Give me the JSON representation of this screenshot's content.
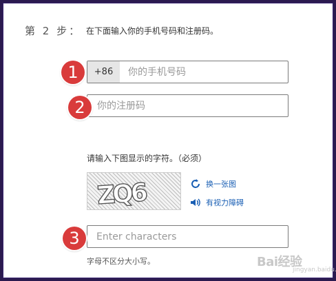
{
  "step": {
    "label": "第 2 步：",
    "description": "在下面输入你的手机号码和注册码。"
  },
  "badges": [
    "1",
    "2",
    "3"
  ],
  "phone": {
    "prefix": "+86",
    "placeholder": "你的手机号码"
  },
  "regcode": {
    "placeholder": "你的注册码"
  },
  "captcha": {
    "label": "请输入下图显示的字符。（必须）",
    "image_text": "ZQ6",
    "refresh_label": "换一张图",
    "audio_label": "有视力障碍",
    "input_placeholder": "Enter characters",
    "hint": "字母不区分大小写。"
  },
  "watermark": {
    "text": "Bai经验",
    "sub": "jingyan.baidu.com"
  },
  "colors": {
    "badge": "#d93b3b",
    "link": "#1a5fb4",
    "border": "#7a7a7a",
    "frame": "#2b1a4f"
  }
}
